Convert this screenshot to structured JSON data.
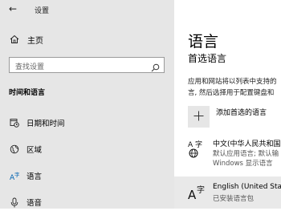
{
  "window": {
    "title": "设置"
  },
  "sidebar": {
    "home_label": "主页",
    "search_placeholder": "查找设置",
    "section_title": "时间和语言",
    "items": [
      {
        "label": "日期和时间",
        "icon": "calendar-clock-icon"
      },
      {
        "label": "区域",
        "icon": "globe-region-icon"
      },
      {
        "label": "语言",
        "icon": "language-icon",
        "selected": true
      },
      {
        "label": "语音",
        "icon": "microphone-icon"
      }
    ]
  },
  "main": {
    "title": "语言",
    "subtitle": "首选语言",
    "description_line1": "应用和网站将以列表中支持的",
    "description_line2": "言, 然后选择用于配置键盘和",
    "add_label": "添加首选的语言",
    "languages": [
      {
        "name": "中文(中华人民共和国)",
        "status1": "默认应用语言; 默认输",
        "status2": "Windows 显示语言",
        "icon": "language-display-icon"
      },
      {
        "name": "English (United States)",
        "status1": "已安装语言包",
        "icon": "language-pack-icon"
      }
    ]
  },
  "colors": {
    "sidebar_bg": "#e6e6e6",
    "selected_accent": "#0063b1",
    "selected_row": "#e9e9e9"
  }
}
